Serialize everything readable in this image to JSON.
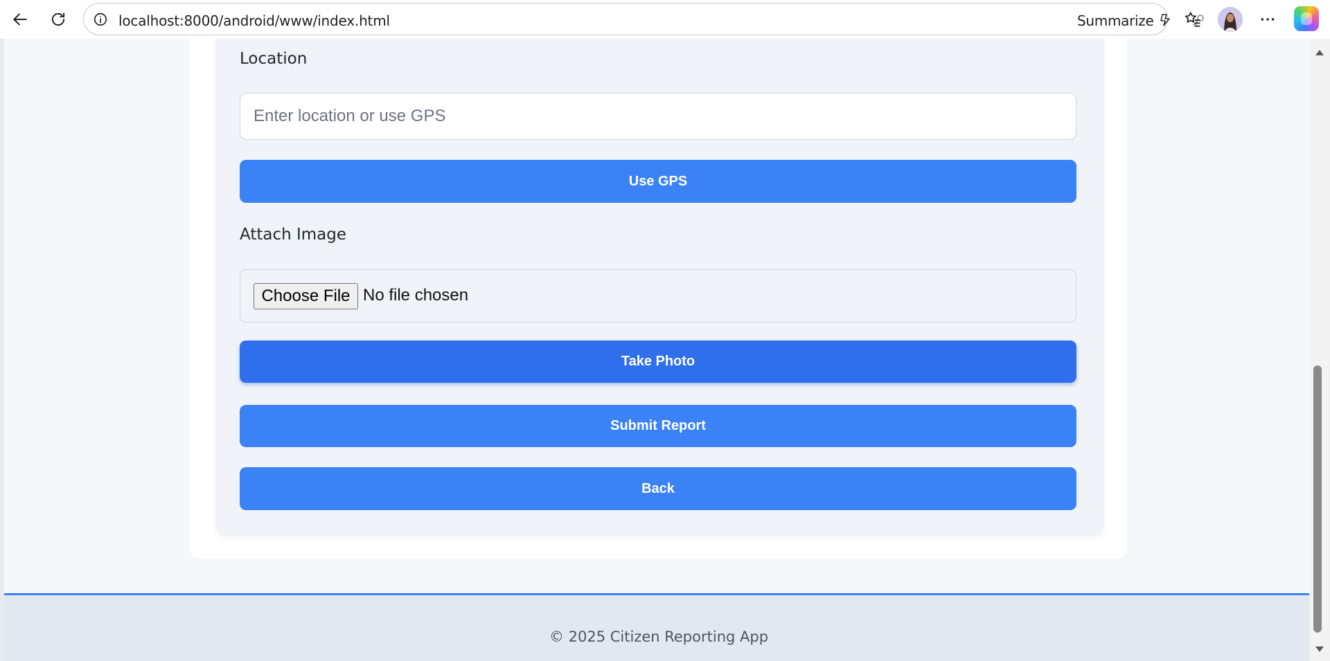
{
  "browser": {
    "url": "localhost:8000/android/www/index.html",
    "summarize_label": "Summarize",
    "icons": [
      "back-arrow-icon",
      "refresh-icon",
      "info-icon",
      "copilot-mode-icon",
      "key-icon",
      "star-icon",
      "favorites-icon",
      "avatar",
      "more-icon",
      "copilot-icon"
    ]
  },
  "form": {
    "location_label": "Location",
    "location_placeholder": "Enter location or use GPS",
    "use_gps_label": "Use GPS",
    "attach_image_label": "Attach Image",
    "choose_file_label": "Choose File",
    "file_status": "No file chosen",
    "take_photo_label": "Take Photo",
    "submit_label": "Submit Report",
    "back_label": "Back"
  },
  "footer": {
    "text": "© 2025 Citizen Reporting App"
  },
  "colors": {
    "primary": "#3b82f6",
    "primary_active": "#2f6fec",
    "page_bg": "#f4f8fb",
    "card_bg": "#f0f3f8",
    "footer_bg": "#e2e8f0"
  }
}
